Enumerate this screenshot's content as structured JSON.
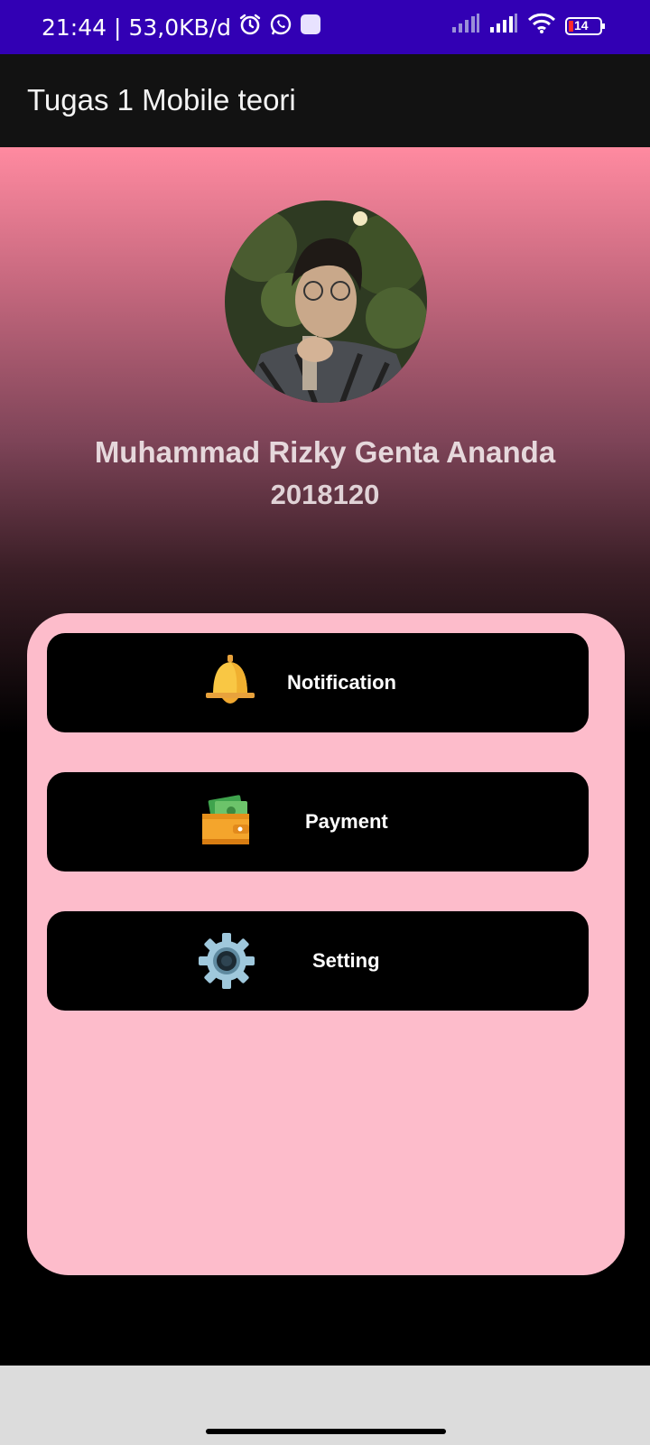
{
  "status_bar": {
    "time": "21:44",
    "speed": "53,0KB/d",
    "battery_level": "14"
  },
  "app_bar": {
    "title": "Tugas 1 Mobile teori"
  },
  "profile": {
    "name": "Muhammad Rizky Genta Ananda",
    "student_id": "2018120"
  },
  "menu": [
    {
      "label": "Notification",
      "icon": "bell-icon"
    },
    {
      "label": "Payment",
      "icon": "wallet-icon"
    },
    {
      "label": "Setting",
      "icon": "gear-icon"
    }
  ],
  "colors": {
    "status_bar": "#3200b4",
    "app_bar": "#121212",
    "card": "#fdbccb",
    "button": "#000000",
    "gradient_top": "#ff8aa0"
  }
}
